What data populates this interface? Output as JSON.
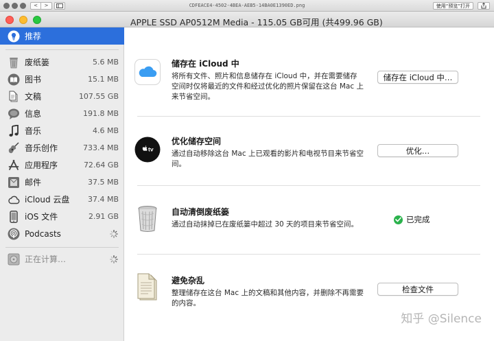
{
  "preview": {
    "filename": "CDFEACE4-4502-4BEA-AEB5-14BA0E1390ED.png",
    "open_with_label": "使用“预览”打开",
    "nav_back": "<",
    "nav_forward": ">",
    "share_icon": "share-icon"
  },
  "window": {
    "title": "APPLE SSD AP0512M Media - 115.05 GB可用 (共499.96 GB)"
  },
  "sidebar": {
    "items": [
      {
        "label": "推荐",
        "size": "",
        "icon": "lightbulb-icon",
        "selected": true
      },
      {
        "label": "废纸篓",
        "size": "5.6 MB",
        "icon": "trash-icon"
      },
      {
        "label": "图书",
        "size": "15.1 MB",
        "icon": "book-icon"
      },
      {
        "label": "文稿",
        "size": "107.55 GB",
        "icon": "document-icon"
      },
      {
        "label": "信息",
        "size": "191.8 MB",
        "icon": "message-icon"
      },
      {
        "label": "音乐",
        "size": "4.6 MB",
        "icon": "music-note-icon"
      },
      {
        "label": "音乐创作",
        "size": "733.4 MB",
        "icon": "guitar-icon"
      },
      {
        "label": "应用程序",
        "size": "72.64 GB",
        "icon": "app-store-icon"
      },
      {
        "label": "邮件",
        "size": "37.5 MB",
        "icon": "mail-icon"
      },
      {
        "label": "iCloud 云盘",
        "size": "37.4 MB",
        "icon": "cloud-icon"
      },
      {
        "label": "iOS 文件",
        "size": "2.91 GB",
        "icon": "phone-icon"
      },
      {
        "label": "Podcasts",
        "size": "",
        "icon": "podcast-icon",
        "loading": true
      }
    ],
    "computing": {
      "label": "正在计算…",
      "icon": "disk-icon"
    }
  },
  "recommendations": [
    {
      "title": "储存在 iCloud 中",
      "description": "将所有文件、照片和信息储存在 iCloud 中，并在需要储存空间时仅将最近的文件和经过优化的照片保留在这台 Mac 上来节省空间。",
      "action": "储存在 iCloud 中…",
      "icon": "icloud-icon"
    },
    {
      "title": "优化储存空间",
      "description": "通过自动移除这台 Mac 上已观看的影片和电视节目来节省空间。",
      "action": "优化…",
      "icon": "apple-tv-icon"
    },
    {
      "title": "自动清倒废纸篓",
      "description": "通过自动抹掉已在废纸篓中超过 30 天的项目来节省空间。",
      "status": "已完成",
      "icon": "trash-can-icon"
    },
    {
      "title": "避免杂乱",
      "description": "整理储存在这台 Mac 上的文稿和其他内容，并删除不再需要的内容。",
      "action": "检查文件",
      "icon": "documents-icon"
    }
  ],
  "watermark": "知乎 @Silence",
  "colors": {
    "selection": "#2c6fdc",
    "status_green": "#2bb24c"
  }
}
